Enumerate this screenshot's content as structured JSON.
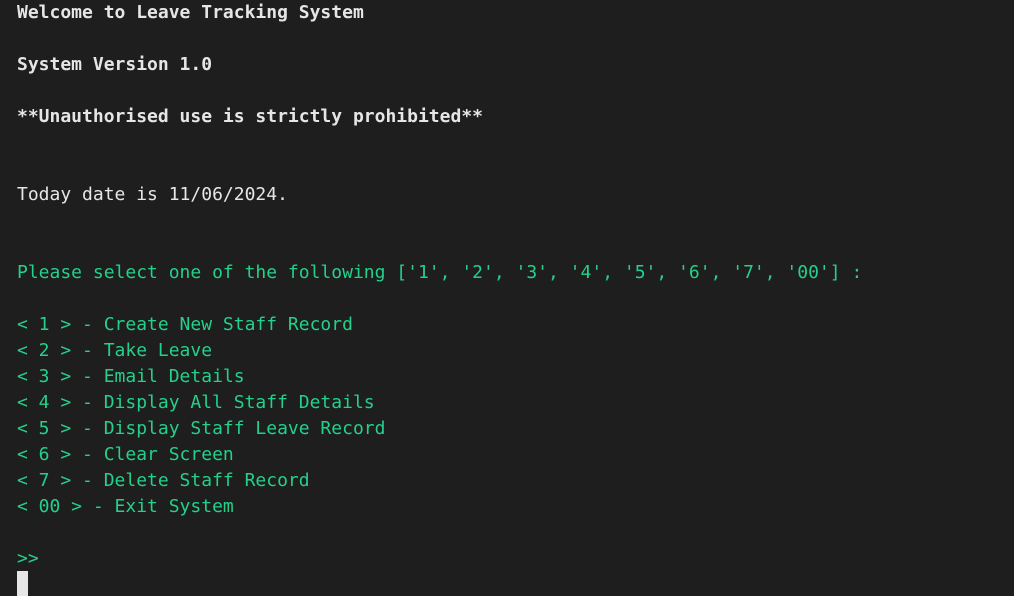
{
  "banner": {
    "welcome": "Welcome to Leave Tracking System",
    "version": "System Version 1.0",
    "warning": "**Unauthorised use is strictly prohibited**"
  },
  "date_line": "Today date is 11/06/2024.",
  "menu": {
    "prompt": "Please select one of the following ['1', '2', '3', '4', '5', '6', '7', '00'] :",
    "items": [
      {
        "label": "< 1 > - Create New Staff Record"
      },
      {
        "label": "< 2 > - Take Leave"
      },
      {
        "label": "< 3 > - Email Details"
      },
      {
        "label": "< 4 > - Display All Staff Details"
      },
      {
        "label": "< 5 > - Display Staff Leave Record"
      },
      {
        "label": "< 6 > - Clear Screen"
      },
      {
        "label": "< 7 > - Delete Staff Record"
      },
      {
        "label": "< 00 > - Exit System"
      }
    ]
  },
  "input_prompt": ">>",
  "colors": {
    "background": "#1e1e1e",
    "text": "#e6e6e6",
    "accent_green": "#23d18b"
  }
}
